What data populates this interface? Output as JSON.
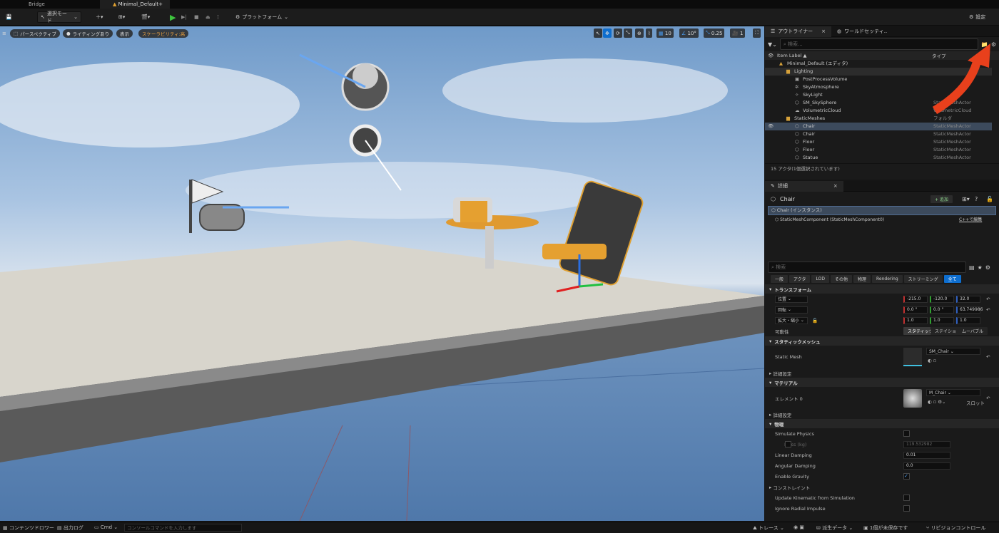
{
  "tabs": {
    "bridge": "Bridge",
    "level": "Minimal_Default+"
  },
  "toolbar": {
    "mode": "選択モード",
    "platforms": "プラットフォーム",
    "settings": "設定"
  },
  "viewport": {
    "perspective": "パースペクティブ",
    "lighting": "ライティングあり",
    "show": "表示",
    "scalability": "スケーラビリティ:高",
    "grid_snap": "10",
    "rot_snap": "10°",
    "scale_snap": "0.25",
    "camera_speed": "1"
  },
  "outliner": {
    "tab": "アウトライナー",
    "world_tab": "ワールドセッティ..",
    "search": "検索...",
    "col_label": "Item Label ▲",
    "col_type": "タイプ",
    "rows": [
      {
        "label": "Minimal_Default (エディタ)",
        "type": ""
      },
      {
        "label": "Lighting",
        "type": ""
      },
      {
        "label": "PostProcessVolume",
        "type": ""
      },
      {
        "label": "SkyAtmosphere",
        "type": ""
      },
      {
        "label": "SkyLight",
        "type": ""
      },
      {
        "label": "SM_SkySphere",
        "type": "StaticMeshActor"
      },
      {
        "label": "VolumetricCloud",
        "type": "VolumetricCloud"
      },
      {
        "label": "StaticMeshes",
        "type": "フォルダ"
      },
      {
        "label": "Chair",
        "type": "StaticMeshActor"
      },
      {
        "label": "Chair",
        "type": "StaticMeshActor"
      },
      {
        "label": "Floor",
        "type": "StaticMeshActor"
      },
      {
        "label": "Floor",
        "type": "StaticMeshActor"
      },
      {
        "label": "Statue",
        "type": "StaticMeshActor"
      }
    ],
    "status": "15 アクタ(1個選択されています)"
  },
  "details": {
    "tab": "詳細",
    "actor": "Chair",
    "add": "+ 追加",
    "instance": "Chair (インスタンス)",
    "component": "StaticMeshComponent (StaticMeshComponent0)",
    "edit_cpp": "C++で編集",
    "search": "検索",
    "filters": [
      "一般",
      "アクタ",
      "LOD",
      "その他",
      "物理",
      "Rendering",
      "ストリーミング",
      "全て"
    ],
    "transform": {
      "title": "トランスフォーム",
      "location": "位置",
      "rotation": "回転",
      "scale": "拡大・縮小",
      "mobility": "可動性",
      "loc": [
        "-215.0",
        "-120.0",
        "32.0"
      ],
      "rot": [
        "0.0 °",
        "0.0 °",
        "63.749986"
      ],
      "scl": [
        "1.0",
        "1.0",
        "1.0"
      ],
      "mob": [
        "スタティック",
        "ステイショ",
        "ムーバブル"
      ]
    },
    "static_mesh": {
      "title": "スタティックメッシュ",
      "label": "Static Mesh",
      "value": "SM_Chair"
    },
    "advanced": "詳細設定",
    "material": {
      "title": "マテリアル",
      "label": "エレメント 0",
      "value": "M_Chair",
      "slot": "スロット"
    },
    "physics": {
      "title": "物理",
      "simulate": "Simulate Physics",
      "mass": "Mass (kg)",
      "mass_val": "119.532982",
      "linear": "Linear Damping",
      "linear_val": "0.01",
      "angular": "Angular Damping",
      "angular_val": "0.0",
      "gravity": "Enable Gravity",
      "constraints": "コンストレイント",
      "kinematic": "Update Kinematic from Simulation",
      "radial": "Ignore Radial Impulse"
    }
  },
  "bottom": {
    "content": "コンテンツドロワー",
    "log": "出力ログ",
    "cmd": "Cmd",
    "console": "コンソールコマンドを入力します",
    "trace": "トレース",
    "derived": "派生データ",
    "unsaved": "1個が未保存です",
    "revision": "リビジョンコントロール"
  }
}
